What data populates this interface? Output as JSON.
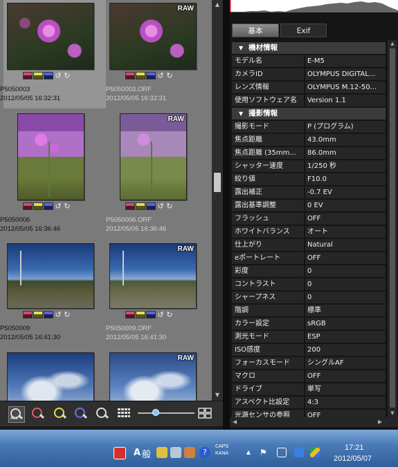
{
  "thumbnails": [
    {
      "filename": "P5050003",
      "date": "2012/05/05 16:32:31",
      "raw": false,
      "selected": true
    },
    {
      "filename": "P5050003.ORF",
      "date": "2012/05/05 16:32:31",
      "raw": true,
      "raw_label": "RAW",
      "selected": false
    },
    {
      "filename": "P5050006",
      "date": "2012/05/05 16:36:46",
      "raw": false,
      "selected": false
    },
    {
      "filename": "P5050006.ORF",
      "date": "2012/05/05 16:36:46",
      "raw": true,
      "raw_label": "RAW",
      "selected": false
    },
    {
      "filename": "P5050009",
      "date": "2012/05/05 16:41:30",
      "raw": false,
      "selected": false
    },
    {
      "filename": "P5050009.ORF",
      "date": "2012/05/05 16:41:30",
      "raw": true,
      "raw_label": "RAW",
      "selected": false
    },
    {
      "filename": "",
      "date": "",
      "raw": false,
      "selected": false
    },
    {
      "filename": "",
      "date": "",
      "raw": true,
      "raw_label": "RAW",
      "selected": false
    }
  ],
  "toolbar": {
    "all_label": "ALL",
    "icons": [
      "search-all-icon",
      "search-red-icon",
      "search-yellow-icon",
      "search-blue-icon",
      "search-icon",
      "grid-view-icon",
      "compare-view-icon"
    ]
  },
  "panel": {
    "tabs": [
      {
        "label": "基本",
        "active": true
      },
      {
        "label": "Exif",
        "active": false
      }
    ],
    "sections": [
      {
        "title": "機材情報",
        "rows": [
          {
            "label": "モデル名",
            "value": "E-M5"
          },
          {
            "label": "カメラID",
            "value": "OLYMPUS DIGITAL..."
          },
          {
            "label": "レンズ情報",
            "value": "OLYMPUS M.12-50..."
          },
          {
            "label": "使用ソフトウェア名",
            "value": "Version 1.1"
          }
        ]
      },
      {
        "title": "撮影情報",
        "rows": [
          {
            "label": "撮影モード",
            "value": "P (プログラム)"
          },
          {
            "label": "焦点距離",
            "value": "43.0mm"
          },
          {
            "label": "焦点距離 (35mm...",
            "value": "86.0mm"
          },
          {
            "label": "シャッター速度",
            "value": "1/250 秒"
          },
          {
            "label": "絞り値",
            "value": "F10.0"
          },
          {
            "label": "露出補正",
            "value": "-0.7 EV"
          },
          {
            "label": "露出基準調整",
            "value": "0 EV"
          },
          {
            "label": "フラッシュ",
            "value": "OFF"
          },
          {
            "label": "ホワイトバランス",
            "value": "オート"
          },
          {
            "label": "仕上がり",
            "value": "Natural"
          },
          {
            "label": "eポートレート",
            "value": "OFF"
          },
          {
            "label": "彩度",
            "value": "0"
          },
          {
            "label": "コントラスト",
            "value": "0"
          },
          {
            "label": "シャープネス",
            "value": "0"
          },
          {
            "label": "階調",
            "value": "標準"
          },
          {
            "label": "カラー設定",
            "value": "sRGB"
          },
          {
            "label": "測光モード",
            "value": "ESP"
          },
          {
            "label": "ISO感度",
            "value": "200"
          },
          {
            "label": "フォーカスモード",
            "value": "シングルAF"
          },
          {
            "label": "マクロ",
            "value": "OFF"
          },
          {
            "label": "ドライブ",
            "value": "単写"
          },
          {
            "label": "アスペクト比設定",
            "value": "4:3"
          },
          {
            "label": "光源センサの参照",
            "value": "OFF"
          }
        ]
      }
    ]
  },
  "taskbar": {
    "ime_a": "A",
    "ime_mode": "般",
    "caps": "CAPS",
    "kana": "KANA",
    "time": "17:21",
    "date": "2012/05/07"
  },
  "colors": {
    "accent_blue": "#7ec4ff",
    "tag_red": "#d84c6c",
    "tag_yellow": "#e3e04a",
    "tag_blue": "#5a64e0"
  }
}
